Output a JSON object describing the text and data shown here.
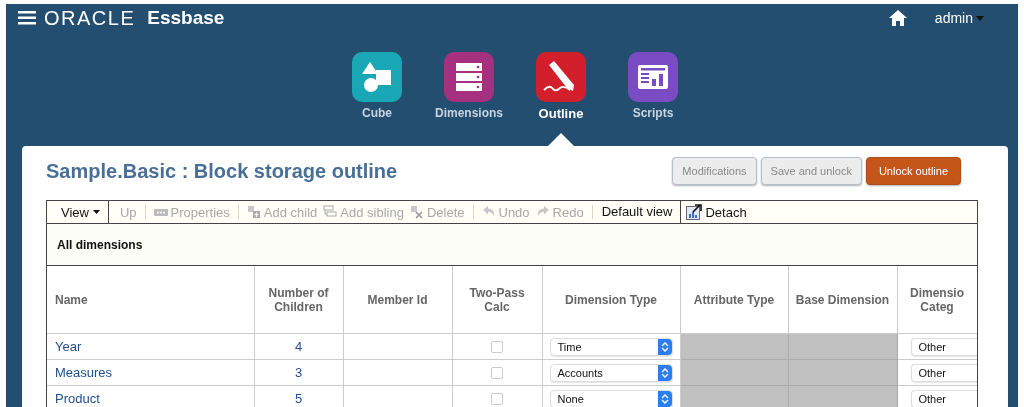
{
  "header": {
    "brand": "ORACLE",
    "product": "Essbase",
    "user": "admin"
  },
  "nav": [
    {
      "label": "Cube",
      "kind": "cube",
      "selected": false
    },
    {
      "label": "Dimensions",
      "kind": "dimensions",
      "selected": false
    },
    {
      "label": "Outline",
      "kind": "outline",
      "selected": true
    },
    {
      "label": "Scripts",
      "kind": "scripts",
      "selected": false
    }
  ],
  "panel": {
    "title": "Sample.Basic : Block storage outline",
    "buttons": [
      {
        "label": "Modifications",
        "kind": "secondary"
      },
      {
        "label": "Save and unlock",
        "kind": "secondary"
      },
      {
        "label": "Unlock outline",
        "kind": "primary"
      }
    ]
  },
  "toolbar": [
    {
      "label": "View",
      "kind": "menu",
      "disabled": false
    },
    {
      "label": "Up",
      "kind": "plain",
      "disabled": true
    },
    {
      "kind": "separator"
    },
    {
      "label": "Properties",
      "kind": "properties",
      "disabled": true
    },
    {
      "kind": "separator"
    },
    {
      "label": "Add child",
      "kind": "add-child",
      "disabled": true
    },
    {
      "label": "Add sibling",
      "kind": "add-sibling",
      "disabled": true
    },
    {
      "label": "Delete",
      "kind": "delete",
      "disabled": true
    },
    {
      "kind": "separator"
    },
    {
      "label": "Undo",
      "kind": "undo",
      "disabled": true
    },
    {
      "label": "Redo",
      "kind": "redo",
      "disabled": true
    },
    {
      "kind": "separator"
    },
    {
      "label": "Default view",
      "kind": "view-field",
      "disabled": false
    },
    {
      "label": "Detach",
      "kind": "detach",
      "disabled": false
    }
  ],
  "section_title": "All dimensions",
  "table": {
    "columns": [
      "Name",
      "Number of Children",
      "Member Id",
      "Two-Pass Calc",
      "Dimension Type",
      "Attribute Type",
      "Base Dimension",
      "Dimensio Categ"
    ],
    "rows": [
      {
        "name": "Year",
        "number_of_children": "4",
        "two_pass_calc": false,
        "dimension_type": "Time",
        "category": "Other"
      },
      {
        "name": "Measures",
        "number_of_children": "3",
        "two_pass_calc": false,
        "dimension_type": "Accounts",
        "category": "Other"
      },
      {
        "name": "Product",
        "number_of_children": "5",
        "two_pass_calc": false,
        "dimension_type": "None",
        "category": "Other"
      }
    ]
  }
}
